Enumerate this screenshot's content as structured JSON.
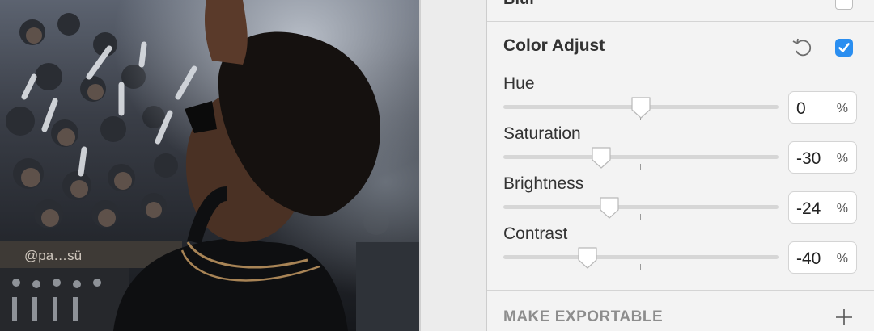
{
  "canvas": {
    "photo_text": "@pa…sü"
  },
  "panel": {
    "previous_section_label": "Blur",
    "color_adjust": {
      "title": "Color Adjust",
      "enabled": true,
      "reset_icon": "reset-icon",
      "sliders": [
        {
          "label": "Hue",
          "value": "0",
          "unit": "%"
        },
        {
          "label": "Saturation",
          "value": "-30",
          "unit": "%"
        },
        {
          "label": "Brightness",
          "value": "-24",
          "unit": "%"
        },
        {
          "label": "Contrast",
          "value": "-40",
          "unit": "%"
        }
      ]
    },
    "make_exportable": {
      "label": "MAKE EXPORTABLE",
      "add_icon": "plus-icon"
    }
  },
  "colors": {
    "accent": "#2a8ef0",
    "panel_bg": "#f3f3f3",
    "track": "#d6d6d6"
  }
}
